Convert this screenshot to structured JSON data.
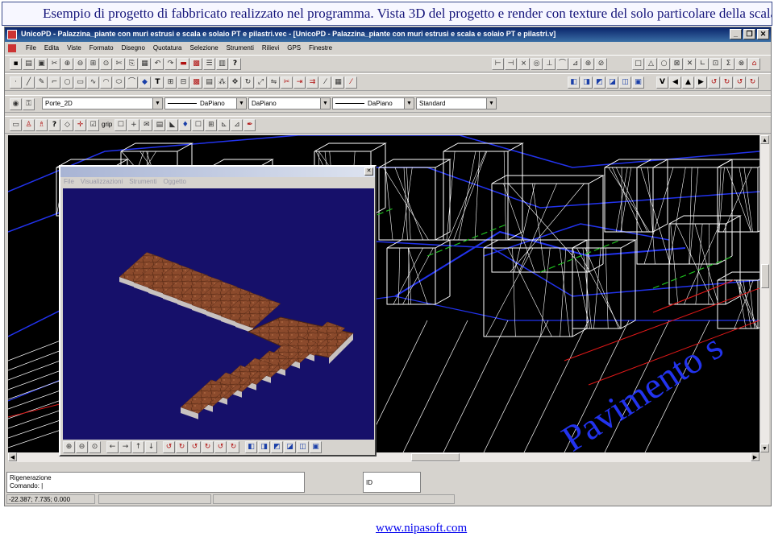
{
  "caption": "Esempio di progetto di fabbricato realizzato nel programma. Vista 3D del progetto e render con texture del solo particolare della scala",
  "window": {
    "title": "UnicoPD - Palazzina_piante con muri estrusi e scala e solaio PT e pilastri.vec - [UnicoPD - Palazzina_piante con muri estrusi e scala e solaio PT e pilastri.v]",
    "minimize": "_",
    "restore": "❐",
    "close": "✕"
  },
  "menu": [
    "File",
    "Edita",
    "Viste",
    "Formato",
    "Disegno",
    "Quotatura",
    "Selezione",
    "Strumenti",
    "Rilievi",
    "GPS",
    "Finestre"
  ],
  "layers": {
    "layer": "Porte_2D",
    "linetype1": "DaPiano",
    "color": "DaPiano",
    "linetype2": "DaPiano",
    "style": "Standard",
    "grip_label": "grip"
  },
  "drawing": {
    "annotation": "Pavimento s"
  },
  "popup": {
    "menu": [
      "File",
      "Visualizzazioni",
      "Strumenti",
      "Oggetto"
    ],
    "close": "✕"
  },
  "command": {
    "line1": "Rigenerazione",
    "line2": "Comando:  |",
    "id_label": "ID",
    "coords": "-22.387; 7.735; 0.000"
  },
  "footer": {
    "link": "www.nipasoft.com"
  },
  "colors": {
    "title_bar": "#0a246a",
    "viewport_bg": "#000000",
    "render_bg": "#16106a",
    "wire_white": "#ffffff",
    "wire_blue": "#2233ee",
    "wire_green": "#1fbf1f",
    "wire_red": "#e01818",
    "stair_texture": "#8b4a2c"
  }
}
